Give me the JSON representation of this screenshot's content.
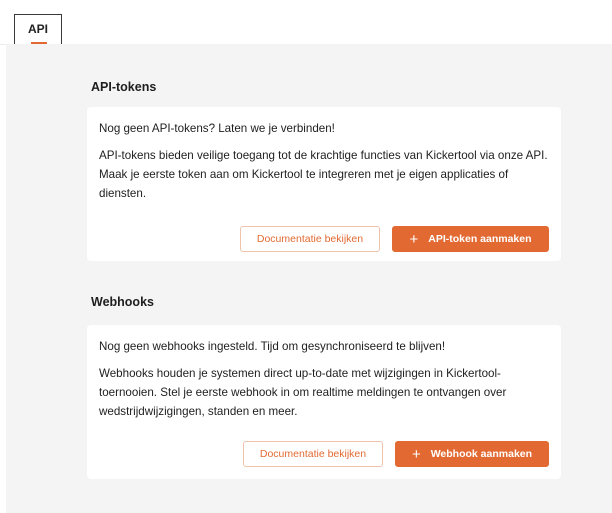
{
  "tabs": [
    {
      "label": "API",
      "active": true
    }
  ],
  "api_tokens": {
    "title": "API-tokens",
    "headline": "Nog geen API-tokens? Laten we je verbinden!",
    "body": "API-tokens bieden veilige toegang tot de krachtige functies van Kickertool via onze API. Maak je eerste token aan om Kickertool te integreren met je eigen applicaties of diensten.",
    "docs_button": "Documentatie bekijken",
    "create_button": "API-token aanmaken"
  },
  "webhooks": {
    "title": "Webhooks",
    "headline": "Nog geen webhooks ingesteld. Tijd om gesynchroniseerd te blijven!",
    "body": "Webhooks houden je systemen direct up-to-date met wijzigingen in Kickertool-toernooien. Stel je eerste webhook in om realtime meldingen te ontvangen over wedstrijdwijzigingen, standen en meer.",
    "docs_button": "Documentatie bekijken",
    "create_button": "Webhook aanmaken"
  },
  "icons": {
    "plus": "plus-icon"
  },
  "colors": {
    "accent": "#e26a32",
    "page_background": "#f4f4f4",
    "card_background": "#ffffff"
  }
}
